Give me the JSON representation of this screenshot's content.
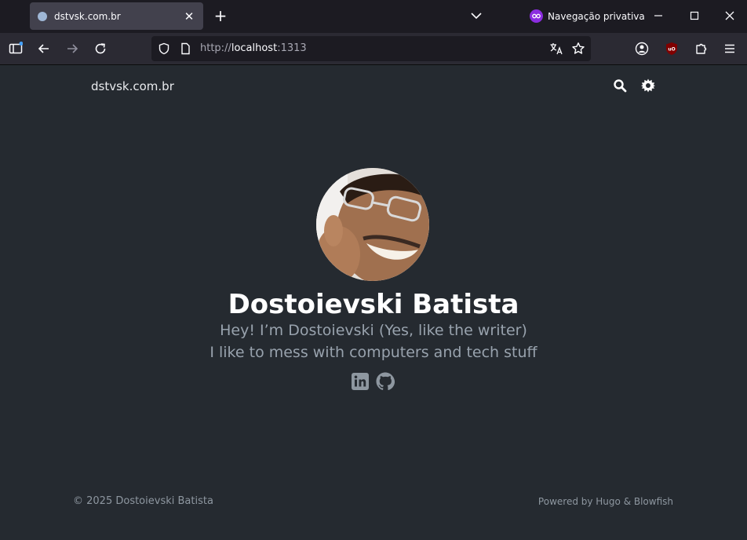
{
  "browser": {
    "tab_title": "dstvsk.com.br",
    "private_label": "Navegação privativa",
    "url_scheme": "http://",
    "url_host": "localhost",
    "url_port": ":1313"
  },
  "site": {
    "title": "dstvsk.com.br"
  },
  "profile": {
    "name": "Dostoievski Batista",
    "headline_1": "Hey! I’m Dostoievski (Yes, like the writer)",
    "headline_2": "I like to mess with computers and tech stuff"
  },
  "footer": {
    "copyright": "© 2025 Dostoievski Batista",
    "powered": "Powered by Hugo & Blowfish"
  },
  "colors": {
    "background": "#252a30",
    "tabbar": "#1c1b22",
    "toolbar": "#2b2a33",
    "muted_text": "#98a2ad"
  }
}
